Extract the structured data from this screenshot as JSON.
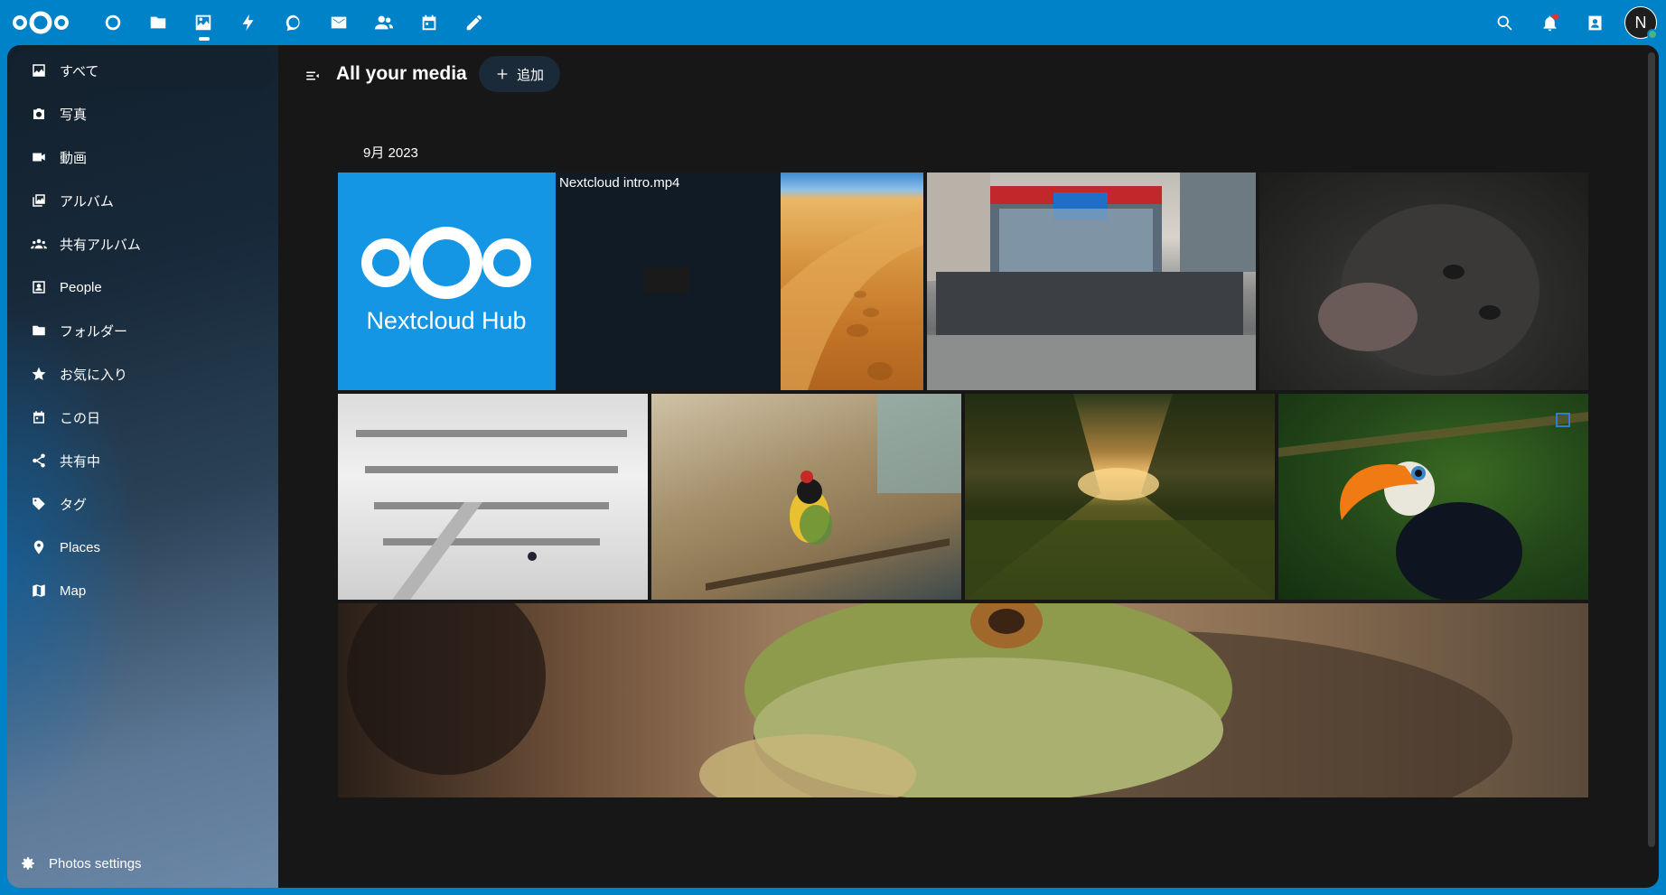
{
  "apps": [
    {
      "name": "dashboard",
      "icon": "circle-icon"
    },
    {
      "name": "files",
      "icon": "folder-icon"
    },
    {
      "name": "photos",
      "icon": "image-icon",
      "active": true
    },
    {
      "name": "activity",
      "icon": "lightning-icon"
    },
    {
      "name": "talk",
      "icon": "chat-icon"
    },
    {
      "name": "mail",
      "icon": "mail-icon"
    },
    {
      "name": "contacts",
      "icon": "people-icon"
    },
    {
      "name": "calendar",
      "icon": "calendar-icon"
    },
    {
      "name": "notes",
      "icon": "pencil-icon"
    }
  ],
  "user": {
    "initial": "N"
  },
  "sidebar": {
    "items": [
      {
        "label": "すべて",
        "icon": "image-icon",
        "active": true
      },
      {
        "label": "写真",
        "icon": "camera-icon"
      },
      {
        "label": "動画",
        "icon": "video-icon"
      },
      {
        "label": "アルバム",
        "icon": "album-icon"
      },
      {
        "label": "共有アルバム",
        "icon": "group-icon"
      },
      {
        "label": "People",
        "icon": "portrait-icon"
      },
      {
        "label": "フォルダー",
        "icon": "folder-icon"
      },
      {
        "label": "お気に入り",
        "icon": "star-icon"
      },
      {
        "label": "この日",
        "icon": "calendar-today-icon"
      },
      {
        "label": "共有中",
        "icon": "share-icon"
      },
      {
        "label": "タグ",
        "icon": "tag-icon"
      },
      {
        "label": "Places",
        "icon": "map-marker-icon"
      },
      {
        "label": "Map",
        "icon": "map-icon"
      }
    ],
    "settings_label": "Photos settings"
  },
  "main": {
    "title": "All your media",
    "add_label": "追加",
    "month": "9月 2023",
    "video_name": "Nextcloud intro.mp4",
    "logo_text": "Nextcloud Hub"
  },
  "colors": {
    "brand": "#0082c9",
    "background": "#171717"
  }
}
